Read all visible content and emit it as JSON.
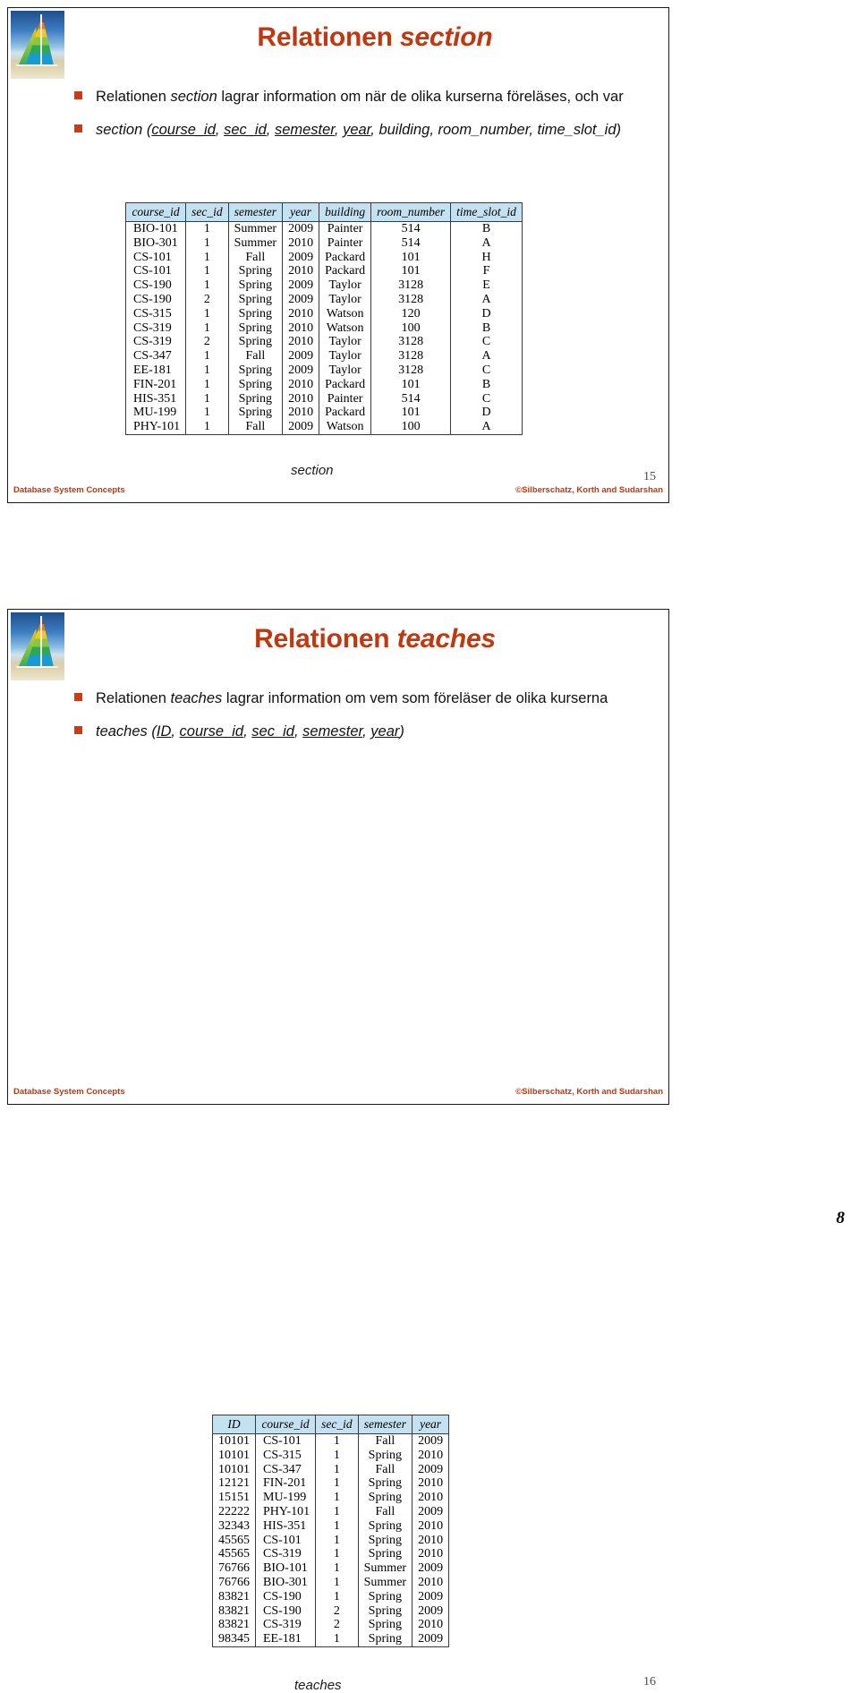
{
  "document": {
    "page_number": "8"
  },
  "slides": [
    {
      "id": "section",
      "title_plain": "Relationen ",
      "title_em": "section",
      "number": "15",
      "caption": "section",
      "bullets": [
        {
          "pre": "Relationen ",
          "em": "section",
          "post": " lagrar information om när de olika kurserna föreläses, och var"
        },
        {
          "text": "section (course_id, sec_id, semester, year, building, room_number, time_slot_id)",
          "rel_name": "section (",
          "keys": [
            "course_id",
            "sec_id",
            "semester",
            "year"
          ],
          "nonkeys": [
            "building",
            "room_number",
            "time_slot_id"
          ]
        }
      ],
      "footer": {
        "left": "Database System Concepts",
        "right": "©Silberschatz, Korth and Sudarshan"
      },
      "table": {
        "columns": [
          "course_id",
          "sec_id",
          "semester",
          "year",
          "building",
          "room_number",
          "time_slot_id"
        ],
        "rows": [
          [
            "BIO-101",
            "1",
            "Summer",
            "2009",
            "Painter",
            "514",
            "B"
          ],
          [
            "BIO-301",
            "1",
            "Summer",
            "2010",
            "Painter",
            "514",
            "A"
          ],
          [
            "CS-101",
            "1",
            "Fall",
            "2009",
            "Packard",
            "101",
            "H"
          ],
          [
            "CS-101",
            "1",
            "Spring",
            "2010",
            "Packard",
            "101",
            "F"
          ],
          [
            "CS-190",
            "1",
            "Spring",
            "2009",
            "Taylor",
            "3128",
            "E"
          ],
          [
            "CS-190",
            "2",
            "Spring",
            "2009",
            "Taylor",
            "3128",
            "A"
          ],
          [
            "CS-315",
            "1",
            "Spring",
            "2010",
            "Watson",
            "120",
            "D"
          ],
          [
            "CS-319",
            "1",
            "Spring",
            "2010",
            "Watson",
            "100",
            "B"
          ],
          [
            "CS-319",
            "2",
            "Spring",
            "2010",
            "Taylor",
            "3128",
            "C"
          ],
          [
            "CS-347",
            "1",
            "Fall",
            "2009",
            "Taylor",
            "3128",
            "A"
          ],
          [
            "EE-181",
            "1",
            "Spring",
            "2009",
            "Taylor",
            "3128",
            "C"
          ],
          [
            "FIN-201",
            "1",
            "Spring",
            "2010",
            "Packard",
            "101",
            "B"
          ],
          [
            "HIS-351",
            "1",
            "Spring",
            "2010",
            "Painter",
            "514",
            "C"
          ],
          [
            "MU-199",
            "1",
            "Spring",
            "2010",
            "Packard",
            "101",
            "D"
          ],
          [
            "PHY-101",
            "1",
            "Fall",
            "2009",
            "Watson",
            "100",
            "A"
          ]
        ]
      }
    },
    {
      "id": "teaches",
      "title_plain": "Relationen ",
      "title_em": "teaches",
      "number": "16",
      "caption": "teaches",
      "bullets": [
        {
          "pre": "Relationen ",
          "em": "teaches",
          "post": " lagrar information om vem som föreläser de olika kurserna"
        },
        {
          "text": "teaches (ID, course_id, sec_id, semester, year)",
          "rel_name": "teaches (",
          "keys": [
            "ID",
            "course_id",
            "sec_id",
            "semester",
            "year"
          ],
          "nonkeys": []
        }
      ],
      "footer": {
        "left": "Database System Concepts",
        "right": "©Silberschatz, Korth and Sudarshan"
      },
      "table": {
        "columns": [
          "ID",
          "course_id",
          "sec_id",
          "semester",
          "year"
        ],
        "rows": [
          [
            "10101",
            "CS-101",
            "1",
            "Fall",
            "2009"
          ],
          [
            "10101",
            "CS-315",
            "1",
            "Spring",
            "2010"
          ],
          [
            "10101",
            "CS-347",
            "1",
            "Fall",
            "2009"
          ],
          [
            "12121",
            "FIN-201",
            "1",
            "Spring",
            "2010"
          ],
          [
            "15151",
            "MU-199",
            "1",
            "Spring",
            "2010"
          ],
          [
            "22222",
            "PHY-101",
            "1",
            "Fall",
            "2009"
          ],
          [
            "32343",
            "HIS-351",
            "1",
            "Spring",
            "2010"
          ],
          [
            "45565",
            "CS-101",
            "1",
            "Spring",
            "2010"
          ],
          [
            "45565",
            "CS-319",
            "1",
            "Spring",
            "2010"
          ],
          [
            "76766",
            "BIO-101",
            "1",
            "Summer",
            "2009"
          ],
          [
            "76766",
            "BIO-301",
            "1",
            "Summer",
            "2010"
          ],
          [
            "83821",
            "CS-190",
            "1",
            "Spring",
            "2009"
          ],
          [
            "83821",
            "CS-190",
            "2",
            "Spring",
            "2009"
          ],
          [
            "83821",
            "CS-319",
            "2",
            "Spring",
            "2010"
          ],
          [
            "98345",
            "EE-181",
            "1",
            "Spring",
            "2009"
          ]
        ]
      }
    }
  ],
  "colors": {
    "title": "#c0380f",
    "bullet_marker": "#cc3a16",
    "table_header_bg": "#c3e1f1",
    "footer_text": "#c0380f"
  },
  "icons": {
    "logo": "sailboat-logo",
    "bullet": "square-bullet-icon"
  }
}
